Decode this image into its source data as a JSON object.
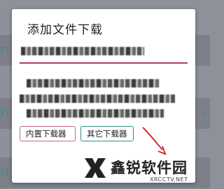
{
  "dialog": {
    "title": "添加文件下载",
    "url_field": {
      "value": ""
    },
    "buttons": {
      "internal_downloader": "内置下载器",
      "other_downloader": "其它下载器"
    }
  },
  "watermark": {
    "name": "鑫锐软件园",
    "site": "XRCCTV.NET"
  },
  "colors": {
    "accent_pink": "#b03c66",
    "accent_teal": "#2f8f88",
    "annotation_red": "#d0312d",
    "dim_background": "#8e9199"
  },
  "icons": {
    "bookmark": "bookmark-icon",
    "chevron": "chevron-right-icon",
    "logo": "brand-x-logo"
  }
}
